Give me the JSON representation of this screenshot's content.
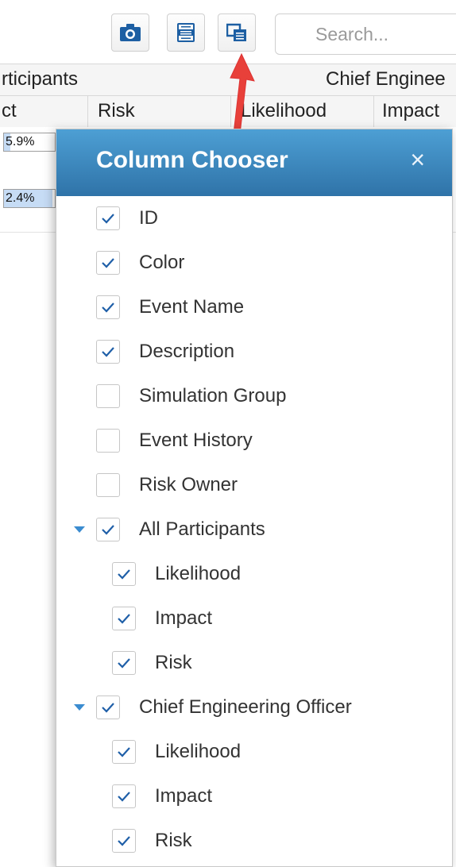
{
  "toolbar": {
    "search_placeholder": "Search..."
  },
  "grid": {
    "header_groups": [
      "rticipants",
      "Chief Enginee"
    ],
    "columns": [
      "ct",
      "Risk",
      "Likelihood",
      "Impact"
    ],
    "rows": [
      {
        "value_label": "5.9%",
        "fill": 0.12
      },
      {
        "value_label": "2.4%",
        "fill": 0.95
      }
    ]
  },
  "dialog": {
    "title": "Column Chooser",
    "close_glyph": "×",
    "items": [
      {
        "label": "ID",
        "checked": true
      },
      {
        "label": "Color",
        "checked": true
      },
      {
        "label": "Event Name",
        "checked": true
      },
      {
        "label": "Description",
        "checked": true
      },
      {
        "label": "Simulation Group",
        "checked": false
      },
      {
        "label": "Event History",
        "checked": false
      },
      {
        "label": "Risk Owner",
        "checked": false
      },
      {
        "label": "All Participants",
        "checked": true,
        "expanded": true
      },
      {
        "label": "Likelihood",
        "checked": true
      },
      {
        "label": "Impact",
        "checked": true
      },
      {
        "label": "Risk",
        "checked": true
      },
      {
        "label": "Chief Engineering Officer",
        "checked": true,
        "expanded": true
      },
      {
        "label": "Likelihood",
        "checked": true
      },
      {
        "label": "Impact",
        "checked": true
      },
      {
        "label": "Risk",
        "checked": true
      }
    ]
  },
  "colors": {
    "accent": "#2f73a8",
    "header_top": "#4d9fd4",
    "check": "#1f5fa8",
    "arrow": "#e8403a",
    "icon": "#1d5fa3"
  },
  "icons": {
    "camera": "camera-icon",
    "xlsx": "xlsx-export-icon",
    "column_chooser": "column-chooser-icon",
    "search": "search-icon"
  }
}
